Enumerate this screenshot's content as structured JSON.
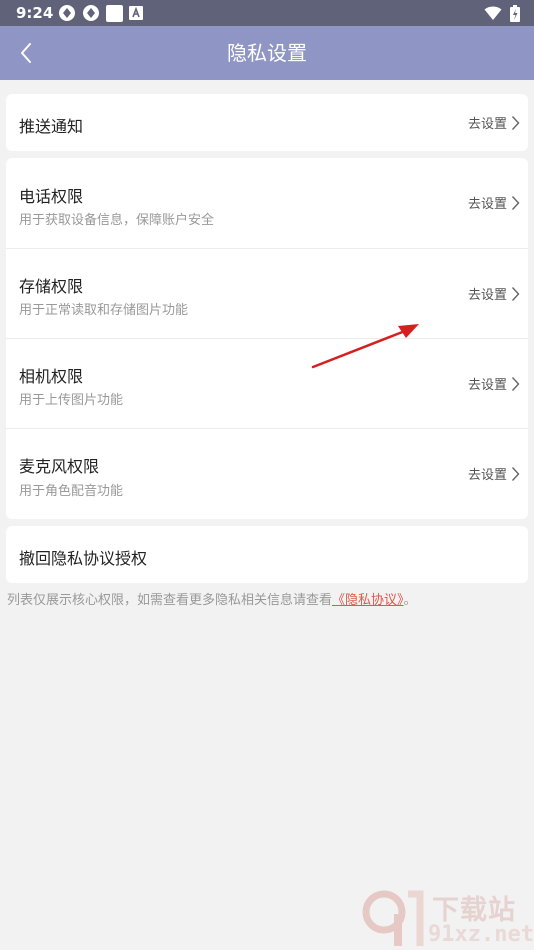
{
  "status_bar": {
    "time": "9:24",
    "notification_icons": [
      "sync-icon",
      "sync-icon",
      "square-icon",
      "a-box-icon"
    ],
    "system_icons": [
      "wifi-icon",
      "battery-icon"
    ]
  },
  "header": {
    "title": "隐私设置",
    "back_icon": "chevron-left-icon",
    "background": "#8f95c4"
  },
  "notification_card": {
    "title": "推送通知",
    "action": "去设置"
  },
  "permissions": [
    {
      "title": "电话权限",
      "subtitle": "用于获取设备信息，保障账户安全",
      "action": "去设置"
    },
    {
      "title": "存储权限",
      "subtitle": "用于正常读取和存储图片功能",
      "action": "去设置"
    },
    {
      "title": "相机权限",
      "subtitle": "用于上传图片功能",
      "action": "去设置"
    },
    {
      "title": "麦克风权限",
      "subtitle": "用于角色配音功能",
      "action": "去设置"
    }
  ],
  "revoke_card": {
    "title": "撤回隐私协议授权"
  },
  "footer": {
    "note": "列表仅展示核心权限，如需查看更多隐私相关信息请查看",
    "link": "《隐私协议》",
    "end": "。",
    "link_color": "#e0584a"
  },
  "watermark": {
    "top": "下载站",
    "bottom": "91xz.net"
  },
  "colors": {
    "status_bar": "#5f6279",
    "background": "#f2f2f2",
    "annotation_arrow": "#d62020"
  }
}
